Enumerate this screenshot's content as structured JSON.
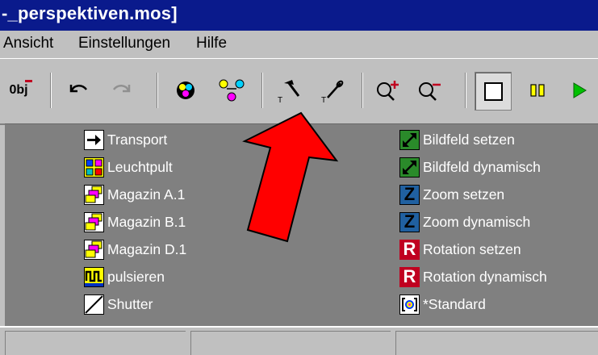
{
  "window": {
    "title": "-_perspektiven.mos]"
  },
  "menu": {
    "items": [
      {
        "label": "Ansicht"
      },
      {
        "label": "Einstellungen"
      },
      {
        "label": "Hilfe"
      }
    ]
  },
  "toolbar": {
    "obj_label": "0bj"
  },
  "panel": {
    "left": [
      {
        "label": "Transport",
        "icon": "arrow-right-icon"
      },
      {
        "label": "Leuchtpult",
        "icon": "light-table-icon"
      },
      {
        "label": "Magazin A.1",
        "icon": "magazine-icon"
      },
      {
        "label": "Magazin B.1",
        "icon": "magazine-icon"
      },
      {
        "label": "Magazin D.1",
        "icon": "magazine-icon"
      },
      {
        "label": "pulsieren",
        "icon": "pulse-icon"
      },
      {
        "label": "Shutter",
        "icon": "shutter-icon"
      }
    ],
    "right": [
      {
        "label": "Bildfeld setzen",
        "icon": "resize-icon",
        "letter": ""
      },
      {
        "label": "Bildfeld dynamisch",
        "icon": "resize-icon",
        "letter": ""
      },
      {
        "label": "Zoom setzen",
        "icon": "zoom-z-icon",
        "letter": "Z"
      },
      {
        "label": "Zoom dynamisch",
        "icon": "zoom-z-icon",
        "letter": "Z"
      },
      {
        "label": "Rotation setzen",
        "icon": "rotation-r-icon",
        "letter": "R"
      },
      {
        "label": "Rotation dynamisch",
        "icon": "rotation-r-icon",
        "letter": "R"
      },
      {
        "label": "*Standard",
        "icon": "standard-icon",
        "letter": ""
      }
    ]
  },
  "colors": {
    "title_bar": "#0a1a8c",
    "panel": "#808080",
    "arrow": "#ff0000",
    "zoom_blue": "#2060a0",
    "rotation_red": "#c00020",
    "resize_green": "#2a8a2a",
    "play_green": "#00c000"
  }
}
